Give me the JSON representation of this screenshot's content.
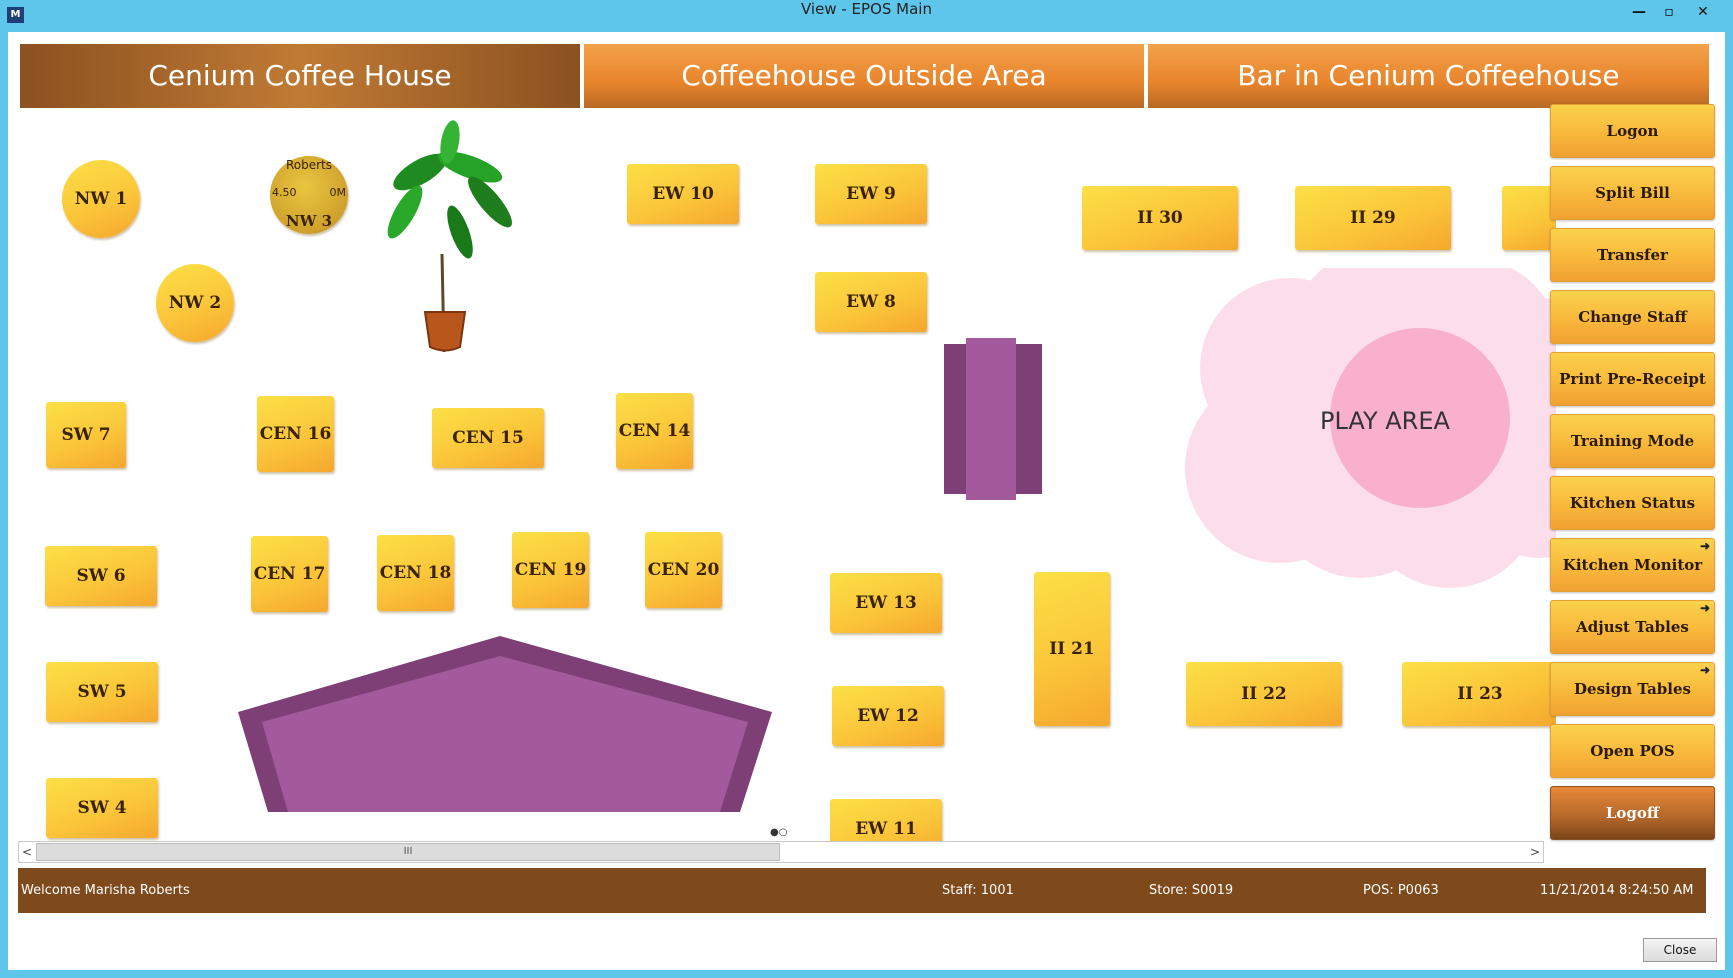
{
  "window": {
    "title": "View - EPOS Main",
    "icon": "app-logo-icon",
    "controls": {
      "minimize": "—",
      "restore": "▫",
      "close": "✕"
    }
  },
  "tabs": [
    {
      "label": "Cenium Coffee House",
      "active": true
    },
    {
      "label": "Coffeehouse Outside Area",
      "active": false
    },
    {
      "label": "Bar in Cenium Coffeehouse",
      "active": false
    }
  ],
  "tables": {
    "nw1": "NW 1",
    "nw2": "NW 2",
    "nw3": {
      "label": "NW 3",
      "staff": "Roberts",
      "amount": "4.50",
      "time": "0M"
    },
    "ew10": "EW 10",
    "ew9": "EW 9",
    "ew8": "EW 8",
    "ii30": "II 30",
    "ii29": "II 29",
    "sw7": "SW 7",
    "cen16": "CEN 16",
    "cen15": "CEN 15",
    "cen14": "CEN 14",
    "sw6": "SW 6",
    "cen17": "CEN 17",
    "cen18": "CEN 18",
    "cen19": "CEN 19",
    "cen20": "CEN 20",
    "ew13": "EW 13",
    "ii21": "II 21",
    "sw5": "SW 5",
    "ew12": "EW 12",
    "ii22": "II 22",
    "ii23": "II 23",
    "sw4": "SW 4",
    "ew11": "EW 11"
  },
  "play_area": {
    "label": "PLAY AREA"
  },
  "sidebar": {
    "buttons": [
      {
        "label": "Logon",
        "submenu": false
      },
      {
        "label": "Split Bill",
        "submenu": false
      },
      {
        "label": "Transfer",
        "submenu": false
      },
      {
        "label": "Change Staff",
        "submenu": false
      },
      {
        "label": "Print Pre-Receipt",
        "submenu": false
      },
      {
        "label": "Training Mode",
        "submenu": false
      },
      {
        "label": "Kitchen Status",
        "submenu": false
      },
      {
        "label": "Kitchen Monitor",
        "submenu": true
      },
      {
        "label": "Adjust Tables",
        "submenu": true
      },
      {
        "label": "Design Tables",
        "submenu": true
      },
      {
        "label": "Open POS",
        "submenu": false
      },
      {
        "label": "Logoff",
        "submenu": false
      }
    ]
  },
  "scrollbar": {
    "left": "<",
    "right": ">",
    "grip": "III"
  },
  "status": {
    "welcome": "Welcome Marisha Roberts",
    "staff": "Staff: 1001",
    "store": "Store: S0019",
    "pos": "POS: P0063",
    "datetime": "11/21/2014 8:24:50 AM"
  },
  "footer": {
    "close_label": "Close"
  },
  "colors": {
    "accent_brown": "#7e4a1c",
    "table_yellow": "#fbc63a",
    "play_pink": "#f7a6c4",
    "furniture_purple": "#9c5797"
  }
}
